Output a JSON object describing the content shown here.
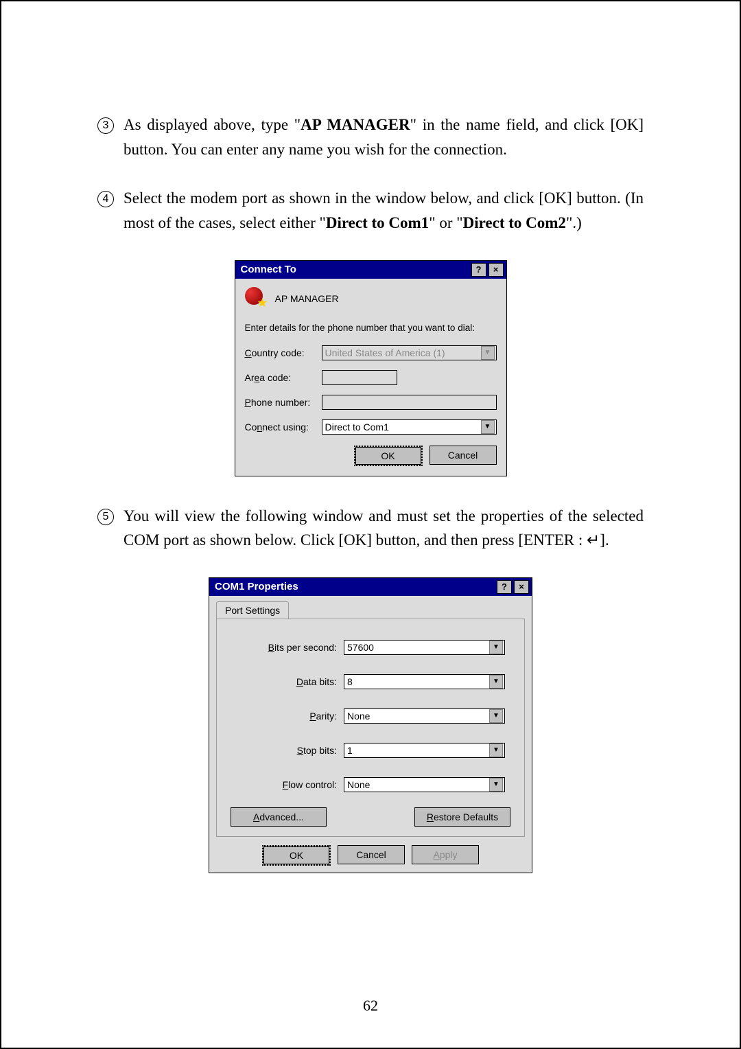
{
  "items": {
    "3": {
      "num": "3",
      "text_a": "As displayed above, type \"",
      "bold_a": "AP MANAGER",
      "text_b": "\" in the name field, and click [OK] button. You can enter any name you wish for the connection."
    },
    "4": {
      "num": "4",
      "text_a": "Select the modem port as shown in the window below, and click [OK] button. (In most of the cases, select either \"",
      "bold_a": "Direct to Com1",
      "text_b": "\" or \"",
      "bold_b": "Direct to Com2",
      "text_c": "\".)"
    },
    "5": {
      "num": "5",
      "text_a": "You will view the following window and must set the properties of the selected COM port as shown below. Click [OK] button, and then press [ENTER : ↵]."
    }
  },
  "dlg1": {
    "title": "Connect To",
    "help": "?",
    "close": "×",
    "app": "AP MANAGER",
    "prompt": "Enter details for the phone number that you want to dial:",
    "country_label": "Country code:",
    "country_value": "United States of America (1)",
    "area_label": "Area code:",
    "area_value": "",
    "phone_label": "Phone number:",
    "phone_value": "",
    "connect_label": "Connect using:",
    "connect_value": "Direct to Com1",
    "ok": "OK",
    "cancel": "Cancel"
  },
  "dlg2": {
    "title": "COM1 Properties",
    "help": "?",
    "close": "×",
    "tab": "Port Settings",
    "bits_label": "Bits per second:",
    "bits_value": "57600",
    "data_label": "Data bits:",
    "data_value": "8",
    "parity_label": "Parity:",
    "parity_value": "None",
    "stop_label": "Stop bits:",
    "stop_value": "1",
    "flow_label": "Flow control:",
    "flow_value": "None",
    "advanced": "Advanced...",
    "restore": "Restore Defaults",
    "ok": "OK",
    "cancel": "Cancel",
    "apply": "Apply"
  },
  "page_number": "62"
}
